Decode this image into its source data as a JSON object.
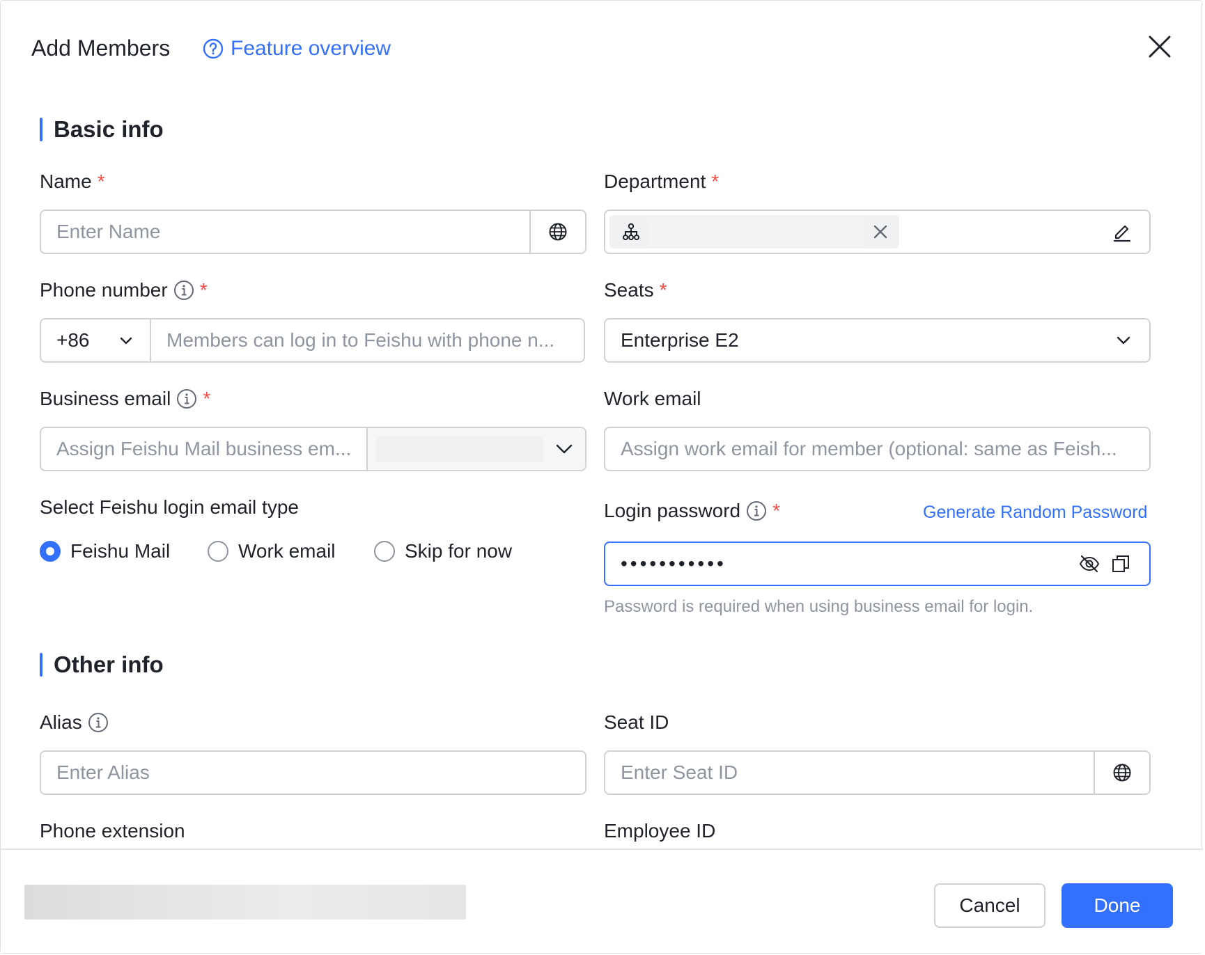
{
  "header": {
    "title": "Add Members",
    "feature_link": "Feature overview"
  },
  "sections": {
    "basic": "Basic info",
    "other": "Other info"
  },
  "fields": {
    "name": {
      "label": "Name",
      "placeholder": "Enter Name"
    },
    "department": {
      "label": "Department"
    },
    "phone": {
      "label": "Phone number",
      "country_code": "+86",
      "placeholder": "Members can log in to Feishu with phone n..."
    },
    "seats": {
      "label": "Seats",
      "value": "Enterprise E2"
    },
    "business_email": {
      "label": "Business email",
      "placeholder": "Assign Feishu Mail business em..."
    },
    "work_email": {
      "label": "Work email",
      "placeholder": "Assign work email for member (optional: same as Feish..."
    },
    "login_email_type": {
      "label": "Select Feishu login email type",
      "options": [
        "Feishu Mail",
        "Work email",
        "Skip for now"
      ],
      "selected": "Feishu Mail"
    },
    "login_password": {
      "label": "Login password",
      "generate_link": "Generate Random Password",
      "value": "•••••••••••",
      "hint": "Password is required when using business email for login."
    },
    "alias": {
      "label": "Alias",
      "placeholder": "Enter Alias"
    },
    "seat_id": {
      "label": "Seat ID",
      "placeholder": "Enter Seat ID"
    },
    "phone_extension": {
      "label": "Phone extension"
    },
    "employee_id": {
      "label": "Employee ID"
    }
  },
  "required_mark": "*",
  "footer": {
    "cancel": "Cancel",
    "done": "Done"
  },
  "colors": {
    "accent": "#3370ff",
    "required": "#f54a45",
    "border": "#d0d3d6",
    "placeholder": "#8f959e"
  }
}
